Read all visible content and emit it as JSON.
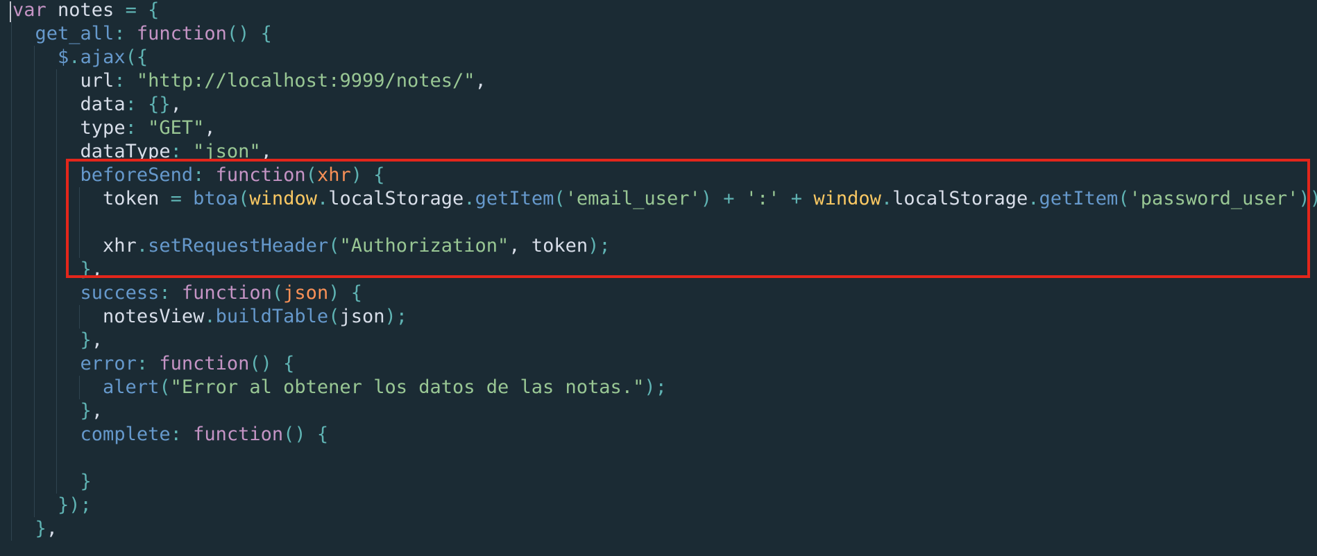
{
  "editor": {
    "language": "javascript",
    "theme_colors": {
      "background": "#1b2b34",
      "keyword": "#c594c5",
      "property": "#6699cc",
      "string": "#99c794",
      "punctuation": "#5fb3b3",
      "parameter": "#f99157",
      "global": "#fac863",
      "plain": "#d8dee9",
      "highlight_border": "#e3261b"
    },
    "lines": [
      {
        "indent": 0,
        "tokens": [
          [
            "kw",
            "var"
          ],
          [
            "var",
            " notes "
          ],
          [
            "op",
            "="
          ],
          [
            "pun",
            " {"
          ]
        ]
      },
      {
        "indent": 1,
        "tokens": [
          [
            "prop",
            "get_all"
          ],
          [
            "pun",
            ": "
          ],
          [
            "kw",
            "function"
          ],
          [
            "pun",
            "() {"
          ]
        ]
      },
      {
        "indent": 2,
        "tokens": [
          [
            "func",
            "$"
          ],
          [
            "pun",
            "."
          ],
          [
            "func",
            "ajax"
          ],
          [
            "pun",
            "({"
          ]
        ]
      },
      {
        "indent": 3,
        "tokens": [
          [
            "var",
            "url"
          ],
          [
            "pun",
            ": "
          ],
          [
            "str",
            "\"http://localhost:9999/notes/\""
          ],
          [
            "var",
            ","
          ]
        ]
      },
      {
        "indent": 3,
        "tokens": [
          [
            "var",
            "data"
          ],
          [
            "pun",
            ": {}"
          ],
          [
            "var",
            ","
          ]
        ]
      },
      {
        "indent": 3,
        "tokens": [
          [
            "var",
            "type"
          ],
          [
            "pun",
            ": "
          ],
          [
            "str",
            "\"GET\""
          ],
          [
            "var",
            ","
          ]
        ]
      },
      {
        "indent": 3,
        "tokens": [
          [
            "var",
            "dataType"
          ],
          [
            "pun",
            ": "
          ],
          [
            "str",
            "\"json\""
          ],
          [
            "var",
            ","
          ]
        ]
      },
      {
        "indent": 3,
        "tokens": [
          [
            "prop",
            "beforeSend"
          ],
          [
            "pun",
            ": "
          ],
          [
            "kw",
            "function"
          ],
          [
            "pun",
            "("
          ],
          [
            "param",
            "xhr"
          ],
          [
            "pun",
            ") {"
          ]
        ]
      },
      {
        "indent": 4,
        "tokens": [
          [
            "var",
            "token "
          ],
          [
            "op",
            "="
          ],
          [
            "var",
            " "
          ],
          [
            "func",
            "btoa"
          ],
          [
            "pun",
            "("
          ],
          [
            "glob",
            "window"
          ],
          [
            "pun",
            "."
          ],
          [
            "var",
            "localStorage"
          ],
          [
            "pun",
            "."
          ],
          [
            "func",
            "getItem"
          ],
          [
            "pun",
            "("
          ],
          [
            "str",
            "'email_user'"
          ],
          [
            "pun",
            ")"
          ],
          [
            "op",
            " + "
          ],
          [
            "str",
            "':'"
          ],
          [
            "op",
            " + "
          ],
          [
            "glob",
            "window"
          ],
          [
            "pun",
            "."
          ],
          [
            "var",
            "localStorage"
          ],
          [
            "pun",
            "."
          ],
          [
            "func",
            "getItem"
          ],
          [
            "pun",
            "("
          ],
          [
            "str",
            "'password_user'"
          ],
          [
            "pun",
            "));"
          ]
        ]
      },
      {
        "indent": 4,
        "tokens": []
      },
      {
        "indent": 4,
        "tokens": [
          [
            "var",
            "xhr"
          ],
          [
            "pun",
            "."
          ],
          [
            "func",
            "setRequestHeader"
          ],
          [
            "pun",
            "("
          ],
          [
            "str",
            "\"Authorization\""
          ],
          [
            "var",
            ", token"
          ],
          [
            "pun",
            ");"
          ]
        ]
      },
      {
        "indent": 3,
        "tokens": [
          [
            "pun",
            "}"
          ],
          [
            "var",
            ","
          ]
        ]
      },
      {
        "indent": 3,
        "tokens": [
          [
            "prop",
            "success"
          ],
          [
            "pun",
            ": "
          ],
          [
            "kw",
            "function"
          ],
          [
            "pun",
            "("
          ],
          [
            "param",
            "json"
          ],
          [
            "pun",
            ") {"
          ]
        ]
      },
      {
        "indent": 4,
        "tokens": [
          [
            "var",
            "notesView"
          ],
          [
            "pun",
            "."
          ],
          [
            "func",
            "buildTable"
          ],
          [
            "pun",
            "("
          ],
          [
            "var",
            "json"
          ],
          [
            "pun",
            ");"
          ]
        ]
      },
      {
        "indent": 3,
        "tokens": [
          [
            "pun",
            "}"
          ],
          [
            "var",
            ","
          ]
        ]
      },
      {
        "indent": 3,
        "tokens": [
          [
            "prop",
            "error"
          ],
          [
            "pun",
            ": "
          ],
          [
            "kw",
            "function"
          ],
          [
            "pun",
            "() {"
          ]
        ]
      },
      {
        "indent": 4,
        "tokens": [
          [
            "func",
            "alert"
          ],
          [
            "pun",
            "("
          ],
          [
            "str",
            "\"Error al obtener los datos de las notas.\""
          ],
          [
            "pun",
            ");"
          ]
        ]
      },
      {
        "indent": 3,
        "tokens": [
          [
            "pun",
            "}"
          ],
          [
            "var",
            ","
          ]
        ]
      },
      {
        "indent": 3,
        "tokens": [
          [
            "prop",
            "complete"
          ],
          [
            "pun",
            ": "
          ],
          [
            "kw",
            "function"
          ],
          [
            "pun",
            "() {"
          ]
        ]
      },
      {
        "indent": 3,
        "tokens": []
      },
      {
        "indent": 3,
        "tokens": [
          [
            "pun",
            "}"
          ]
        ]
      },
      {
        "indent": 2,
        "tokens": [
          [
            "pun",
            "});"
          ]
        ]
      },
      {
        "indent": 1,
        "tokens": [
          [
            "pun",
            "}"
          ],
          [
            "var",
            ","
          ]
        ]
      }
    ]
  }
}
